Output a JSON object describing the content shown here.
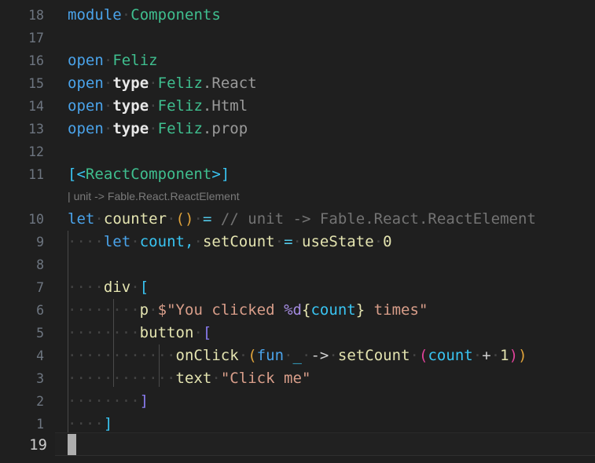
{
  "editor": {
    "name": "code-editor",
    "language": "F#",
    "background_color": "#1f1f1f",
    "font_size_px": 19,
    "line_height_px": 29,
    "current_line_number": "19",
    "line_numbering_mode": "relative"
  },
  "gutter": {
    "numbers": [
      "18",
      "17",
      "16",
      "15",
      "14",
      "13",
      "12",
      "11",
      "10",
      "9",
      "8",
      "7",
      "6",
      "5",
      "4",
      "3",
      "2",
      "1"
    ],
    "current_number": "19"
  },
  "inlay_hint": {
    "text": "| unit -> Fable.React.ReactElement"
  },
  "code_lines": [
    {
      "n": "18",
      "text": "module Components"
    },
    {
      "n": "17",
      "text": ""
    },
    {
      "n": "16",
      "text": "open Feliz"
    },
    {
      "n": "15",
      "text": "open type Feliz.React"
    },
    {
      "n": "14",
      "text": "open type Feliz.Html"
    },
    {
      "n": "13",
      "text": "open type Feliz.prop"
    },
    {
      "n": "12",
      "text": ""
    },
    {
      "n": "11",
      "text": "[<ReactComponent>]"
    },
    {
      "n": "10",
      "text": "let counter () = // unit -> Fable.React.ReactElement"
    },
    {
      "n": "9",
      "text": "    let count, setCount = useState 0"
    },
    {
      "n": "8",
      "text": ""
    },
    {
      "n": "7",
      "text": "    div ["
    },
    {
      "n": "6",
      "text": "        p $\"You clicked %d{count} times\""
    },
    {
      "n": "5",
      "text": "        button ["
    },
    {
      "n": "4",
      "text": "            onClick (fun _ -> setCount (count + 1))"
    },
    {
      "n": "3",
      "text": "            text \"Click me\""
    },
    {
      "n": "2",
      "text": "        ]"
    },
    {
      "n": "1",
      "text": "    ]"
    },
    {
      "n": "19",
      "text": ""
    }
  ],
  "tokens": {
    "module": "module",
    "components": "Components",
    "open": "open",
    "type": "type",
    "feliz": "Feliz",
    "dot_react": ".React",
    "dot_html": ".Html",
    "dot_prop": ".prop",
    "attr_open": "[<",
    "react_component": "ReactComponent",
    "attr_close": ">]",
    "let": "let",
    "counter": "counter",
    "unit_parens": "()",
    "equals": "=",
    "comment": "// unit -> Fable.React.ReactElement",
    "count": "count",
    "comma": ",",
    "set_count": "setCount",
    "use_state": "useState",
    "zero": "0",
    "div": "div",
    "bracket_open": "[",
    "bracket_close": "]",
    "p": "p",
    "dollar": "$",
    "quote": "\"",
    "str_you_clicked": "You clicked ",
    "percent_d": "%d",
    "brace_open": "{",
    "brace_close": "}",
    "str_times": " times",
    "button": "button",
    "on_click": "onClick",
    "paren_open": "(",
    "paren_close": ")",
    "fun": "fun",
    "underscore": "_",
    "arrow": "->",
    "plus": "+",
    "one": "1",
    "text": "text",
    "str_click_me": "Click me",
    "ws_dot": "·"
  },
  "colors": {
    "background": "#1f1f1f",
    "keyword_blue": "#4aa3ea",
    "type_green": "#3fbf8f",
    "identifier_yellow": "#e4e4b0",
    "cyan": "#39c5f3",
    "string_salmon": "#d99e8a",
    "comment_gray": "#737373",
    "gutter_gray": "#6e7681",
    "bracket_purple": "#8a7cf0",
    "paren_orange": "#e0a33a",
    "paren_magenta": "#e0429a",
    "format_purple": "#a48be0",
    "cursor": "#aeaeae",
    "indent_guide": "#4a4a4a"
  }
}
